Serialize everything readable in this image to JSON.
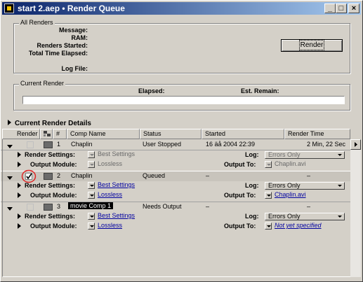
{
  "window": {
    "title": "start 2.aep • Render Queue",
    "controls": {
      "minimize": "_",
      "maximize": "□",
      "close": "×"
    }
  },
  "all_renders": {
    "group_label": "All Renders",
    "message_label": "Message:",
    "ram_label": "RAM:",
    "renders_started_label": "Renders Started:",
    "total_time_label": "Total Time Elapsed:",
    "log_file_label": "Log File:",
    "render_button": "Render"
  },
  "current_render": {
    "group_label": "Current Render",
    "elapsed_label": "Elapsed:",
    "remain_label": "Est. Remain:"
  },
  "details_label": "Current Render Details",
  "columns": {
    "render": "Render",
    "number": "#",
    "comp_name": "Comp Name",
    "status": "Status",
    "started": "Started",
    "render_time": "Render Time"
  },
  "items": [
    {
      "number": "1",
      "comp": "Chaplin",
      "status": "User Stopped",
      "started": "16 äå 2004 22:39",
      "render_time": "2 Min, 22 Sec",
      "render_settings_label": "Render Settings:",
      "render_settings": "Best Settings",
      "output_module_label": "Output Module:",
      "output_module": "Lossless",
      "log_label": "Log:",
      "log": "Errors Only",
      "output_to_label": "Output To:",
      "output_to": "Chaplin.avi"
    },
    {
      "number": "2",
      "comp": "Chaplin",
      "status": "Queued",
      "started": "–",
      "render_time": "–",
      "render_settings_label": "Render Settings:",
      "render_settings": "Best Settings",
      "output_module_label": "Output Module:",
      "output_module": "Lossless",
      "log_label": "Log:",
      "log": "Errors Only",
      "output_to_label": "Output To:",
      "output_to": "Chaplin.avi"
    },
    {
      "number": "3",
      "comp": "movie Comp 1",
      "status": "Needs Output",
      "started": "–",
      "render_time": "–",
      "render_settings_label": "Render Settings:",
      "render_settings": "Best Settings",
      "output_module_label": "Output Module:",
      "output_module": "Lossless",
      "log_label": "Log:",
      "log": "Errors Only",
      "output_to_label": "Output To:",
      "output_to": "Not yet specified"
    }
  ],
  "colors": {
    "titlebar_start": "#0a246a",
    "titlebar_end": "#a6caf0",
    "face": "#d4d0c8",
    "link": "#0000a0",
    "highlight_circle": "#e02020"
  }
}
